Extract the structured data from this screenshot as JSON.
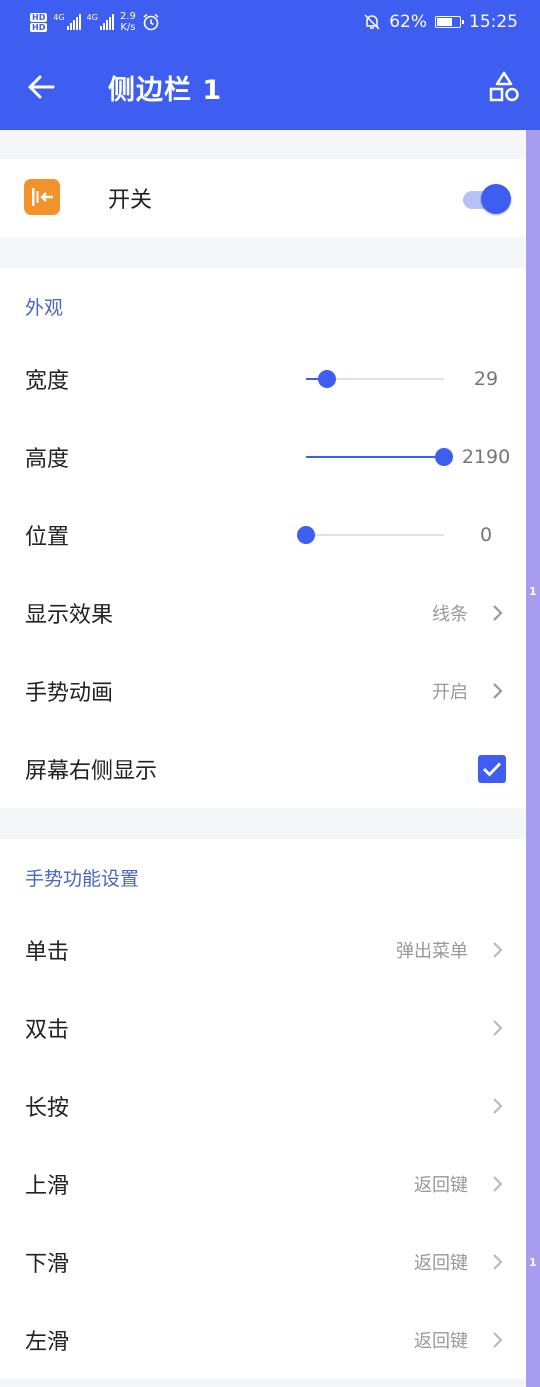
{
  "status": {
    "hd1": "HD",
    "hd2": "HD",
    "net1": "4G",
    "net2": "4G",
    "speed_value": "2.9",
    "speed_unit": "K/s",
    "battery": "62%",
    "time": "15:25"
  },
  "appbar": {
    "title": "侧边栏 1"
  },
  "toggle_row": {
    "label": "开关",
    "on": true
  },
  "appearance": {
    "title": "外观",
    "width": {
      "label": "宽度",
      "value": "29",
      "fraction": 0.15
    },
    "height": {
      "label": "高度",
      "value": "2190",
      "fraction": 1.0
    },
    "position": {
      "label": "位置",
      "value": "0",
      "fraction": 0.0
    },
    "display_effect": {
      "label": "显示效果",
      "value": "线条"
    },
    "gesture_animation": {
      "label": "手势动画",
      "value": "开启"
    },
    "right_side": {
      "label": "屏幕右侧显示",
      "checked": true
    }
  },
  "gestures": {
    "title": "手势功能设置",
    "items": [
      {
        "label": "单击",
        "value": "弹出菜单"
      },
      {
        "label": "双击",
        "value": ""
      },
      {
        "label": "长按",
        "value": ""
      },
      {
        "label": "上滑",
        "value": "返回键"
      },
      {
        "label": "下滑",
        "value": "返回键"
      },
      {
        "label": "左滑",
        "value": "返回键"
      }
    ]
  },
  "scroll_markers": [
    "1",
    "1"
  ],
  "colors": {
    "primary": "#3d5ef0",
    "accent_orange": "#f2922b",
    "section_title": "#4a66c8"
  }
}
